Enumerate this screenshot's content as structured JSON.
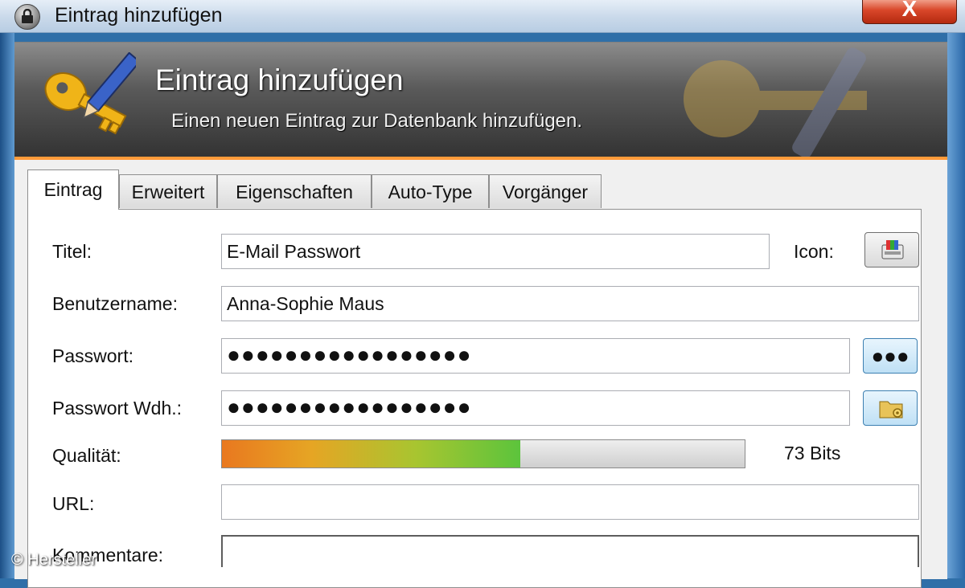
{
  "window": {
    "title": "Eintrag hinzufügen",
    "close_label": "X"
  },
  "banner": {
    "title": "Eintrag hinzufügen",
    "subtitle": "Einen neuen Eintrag zur Datenbank hinzufügen."
  },
  "tabs": [
    {
      "label": "Eintrag",
      "active": true
    },
    {
      "label": "Erweitert"
    },
    {
      "label": "Eigenschaften"
    },
    {
      "label": "Auto-Type"
    },
    {
      "label": "Vorgänger"
    }
  ],
  "form": {
    "title_label": "Titel:",
    "title_value": "E-Mail Passwort",
    "icon_label": "Icon:",
    "username_label": "Benutzername:",
    "username_value": "Anna-Sophie Maus",
    "password_label": "Passwort:",
    "password_value": "●●●●●●●●●●●●●●●●●",
    "password_toggle_label": "●●●",
    "repeat_label": "Passwort Wdh.:",
    "repeat_value": "●●●●●●●●●●●●●●●●●",
    "quality_label": "Qualität:",
    "quality_text": "73 Bits",
    "quality_fraction": 0.57,
    "url_label": "URL:",
    "url_value": "",
    "comments_label": "Kommentare:"
  },
  "credit": "© Hersteller",
  "colors": {
    "accent_orange": "#ff9b3a",
    "banner_dark": "#333333",
    "close_red": "#d9472a"
  }
}
